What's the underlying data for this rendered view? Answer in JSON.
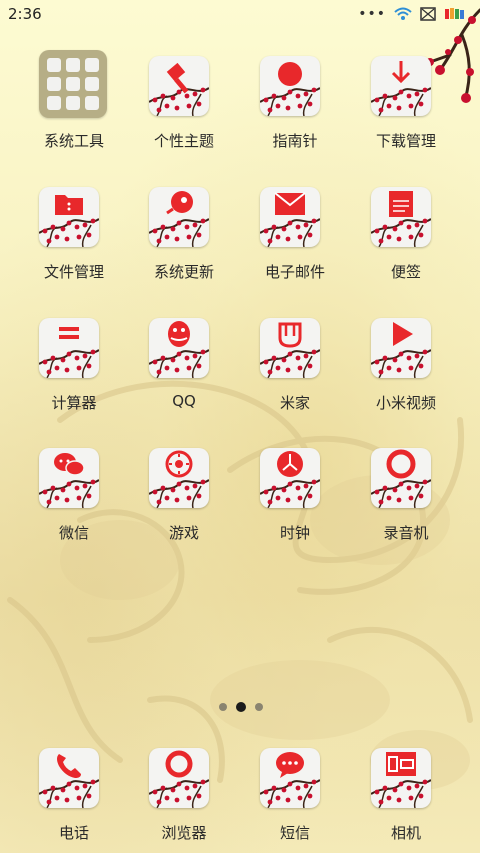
{
  "status_bar": {
    "time": "2:36",
    "icons": [
      "more-dots-icon",
      "wifi-icon",
      "sim-icon",
      "battery-icon"
    ]
  },
  "apps": [
    {
      "label": "系统工具",
      "icon": "folder-icon"
    },
    {
      "label": "个性主题",
      "icon": "theme-brush-icon"
    },
    {
      "label": "指南针",
      "icon": "compass-icon"
    },
    {
      "label": "下载管理",
      "icon": "download-icon"
    },
    {
      "label": "文件管理",
      "icon": "file-folder-icon"
    },
    {
      "label": "系统更新",
      "icon": "rocket-update-icon"
    },
    {
      "label": "电子邮件",
      "icon": "mail-icon"
    },
    {
      "label": "便签",
      "icon": "notes-icon"
    },
    {
      "label": "计算器",
      "icon": "calculator-icon"
    },
    {
      "label": "QQ",
      "icon": "qq-penguin-icon"
    },
    {
      "label": "米家",
      "icon": "mijia-icon"
    },
    {
      "label": "小米视频",
      "icon": "video-play-icon"
    },
    {
      "label": "微信",
      "icon": "wechat-icon"
    },
    {
      "label": "游戏",
      "icon": "game-icon"
    },
    {
      "label": "时钟",
      "icon": "clock-icon"
    },
    {
      "label": "录音机",
      "icon": "recorder-icon"
    }
  ],
  "pager": {
    "count": 3,
    "active_index": 1
  },
  "dock": [
    {
      "label": "电话",
      "icon": "phone-icon"
    },
    {
      "label": "浏览器",
      "icon": "browser-icon"
    },
    {
      "label": "短信",
      "icon": "message-icon"
    },
    {
      "label": "相机",
      "icon": "camera-icon"
    }
  ],
  "colors": {
    "accent": "#e8282b",
    "tile_bg": "#f4f4f2",
    "text": "#2a2a2a"
  }
}
